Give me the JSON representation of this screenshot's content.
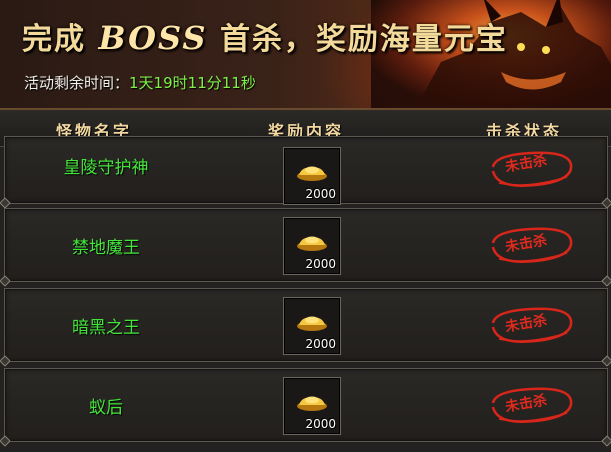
{
  "banner": {
    "title_prefix": "完成",
    "title_boss": "BOSS",
    "title_suffix": "首杀，奖励海量元宝",
    "timer_label": "活动剩余时间：",
    "timer_value": "1天19时11分11秒"
  },
  "table": {
    "headers": [
      "怪物名字",
      "奖励内容",
      "击杀状态"
    ],
    "rows": [
      {
        "monster": "皇陵守护神",
        "reward_amount": "2000",
        "reward_icon": "gold-ingot-icon",
        "status": "未击杀"
      },
      {
        "monster": "禁地魔王",
        "reward_amount": "2000",
        "reward_icon": "gold-ingot-icon",
        "status": "未击杀"
      },
      {
        "monster": "暗黑之王",
        "reward_amount": "2000",
        "reward_icon": "gold-ingot-icon",
        "status": "未击杀"
      },
      {
        "monster": "蚁后",
        "reward_amount": "2000",
        "reward_icon": "gold-ingot-icon",
        "status": "未击杀"
      }
    ]
  },
  "colors": {
    "monster_name": "#44e53a",
    "timer_value": "#7ff04a",
    "header_text": "#f2d8a0",
    "stamp": "#e02a1e"
  }
}
